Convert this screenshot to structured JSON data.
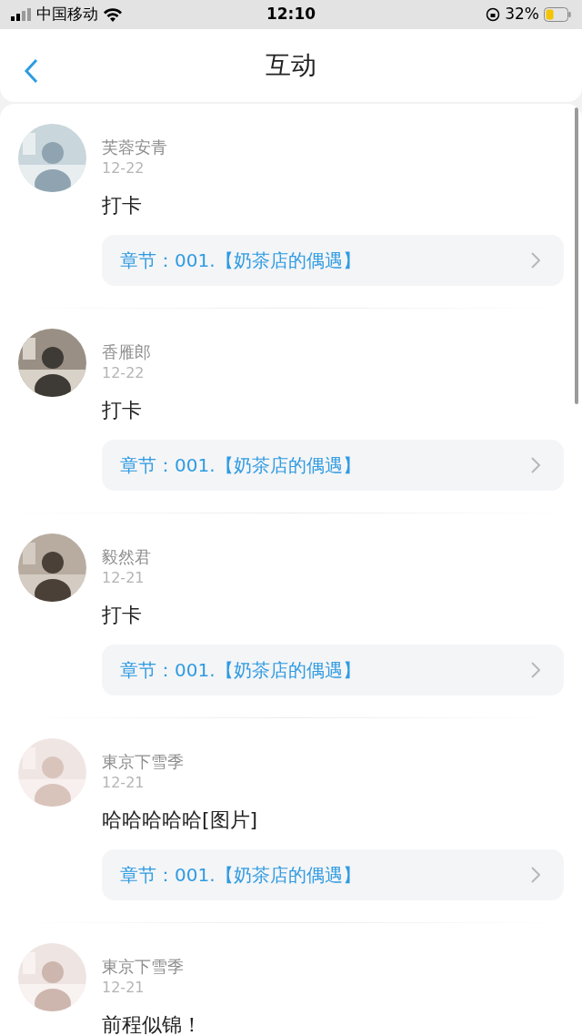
{
  "status_bar": {
    "carrier": "中国移动",
    "time": "12:10",
    "battery": "32%"
  },
  "header": {
    "title": "互动"
  },
  "posts": [
    {
      "name": "芙蓉安青",
      "date": "12-22",
      "content": "打卡",
      "chapter": "章节：001.【奶茶店的偶遇】"
    },
    {
      "name": "香雁郎",
      "date": "12-22",
      "content": "打卡",
      "chapter": "章节：001.【奶茶店的偶遇】"
    },
    {
      "name": "毅然君",
      "date": "12-21",
      "content": "打卡",
      "chapter": "章节：001.【奶茶店的偶遇】"
    },
    {
      "name": "東京下雪季",
      "date": "12-21",
      "content": "哈哈哈哈哈[图片]",
      "chapter": "章节：001.【奶茶店的偶遇】"
    },
    {
      "name": "東京下雪季",
      "date": "12-21",
      "content": "前程似锦！"
    }
  ]
}
